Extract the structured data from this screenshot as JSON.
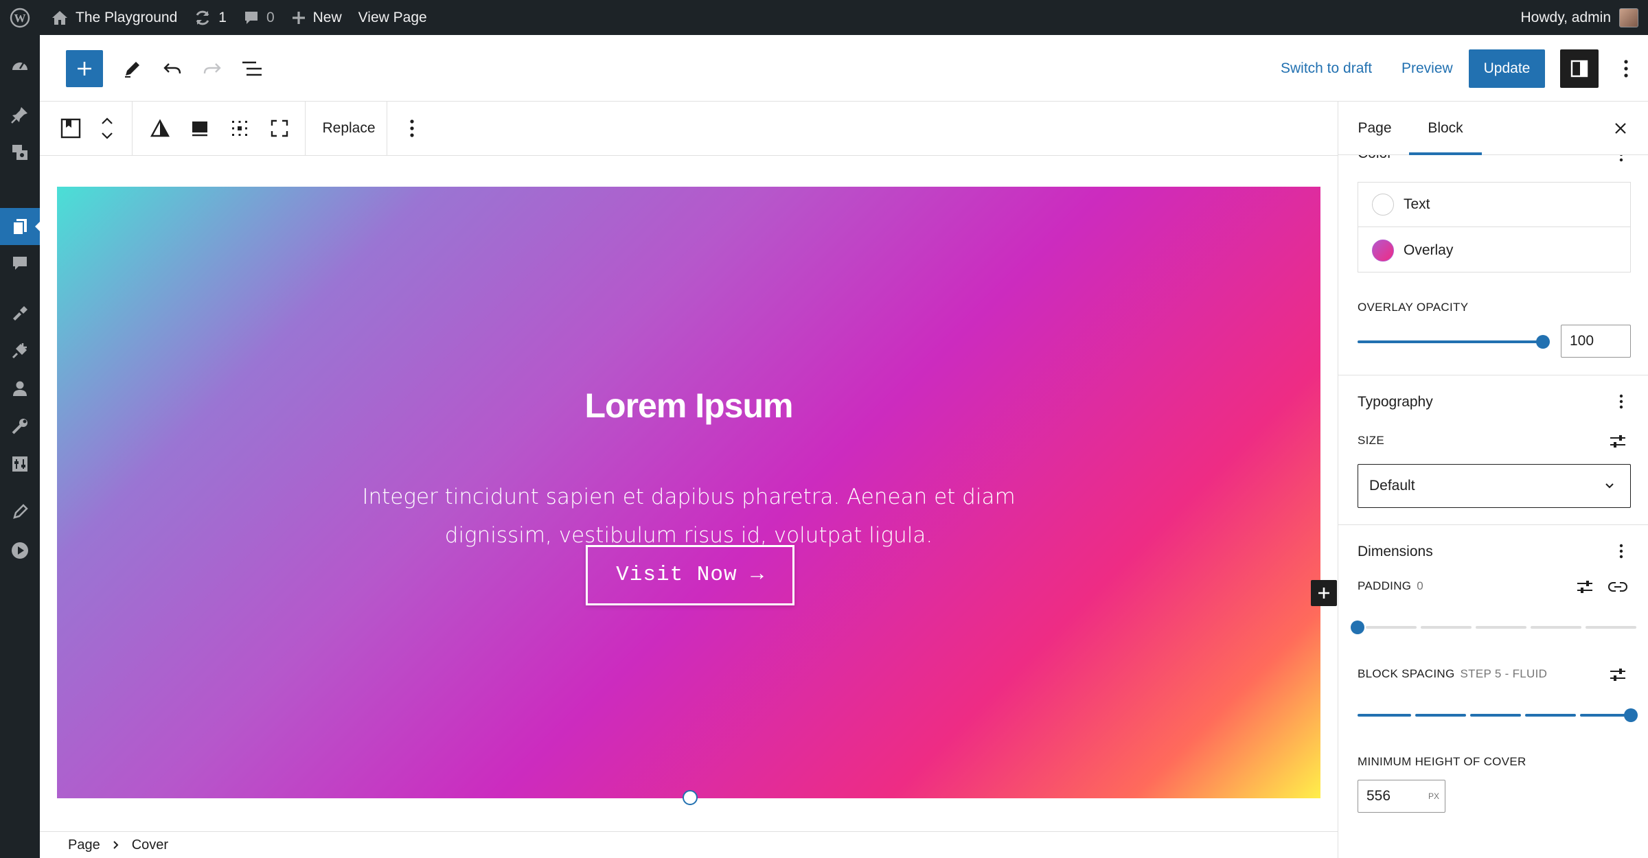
{
  "admin_bar": {
    "site_name": "The Playground",
    "updates_count": "1",
    "comments_count": "0",
    "new_label": "New",
    "view_page_label": "View Page",
    "howdy": "Howdy, admin"
  },
  "header": {
    "switch_to_draft": "Switch to draft",
    "preview": "Preview",
    "update": "Update"
  },
  "block_toolbar": {
    "replace": "Replace"
  },
  "cover": {
    "title": "Lorem Ipsum",
    "text": "Integer tincidunt sapien et dapibus pharetra. Aenean et diam dignissim, vestibulum risus id, volutpat ligula.",
    "button": "Visit Now →",
    "gradient_colors": [
      "#4adfd6",
      "#9a75d3",
      "#cc2bbf",
      "#ee2c84",
      "#ff6b5b",
      "#ffef4a"
    ]
  },
  "breadcrumb": {
    "items": [
      "Page",
      "Cover"
    ]
  },
  "sidebar": {
    "tabs": [
      "Page",
      "Block"
    ],
    "active_tab": "Block",
    "color": {
      "title": "Color",
      "items": [
        {
          "label": "Text",
          "swatch": "#ffffff"
        },
        {
          "label": "Overlay",
          "swatch": "#c94fd0"
        }
      ]
    },
    "overlay_opacity": {
      "label": "Overlay opacity",
      "value": "100"
    },
    "typography": {
      "title": "Typography",
      "size_label": "Size",
      "size_value": "Default"
    },
    "dimensions": {
      "title": "Dimensions",
      "padding_label": "Padding",
      "padding_value": "0",
      "block_spacing_label": "Block spacing",
      "block_spacing_value": "Step 5 - Fluid",
      "min_height_label": "Minimum height of cover",
      "min_height_value": "556",
      "min_height_unit": "PX"
    }
  },
  "colors": {
    "accent": "#2271b1",
    "admin_bar": "#1d2327"
  }
}
